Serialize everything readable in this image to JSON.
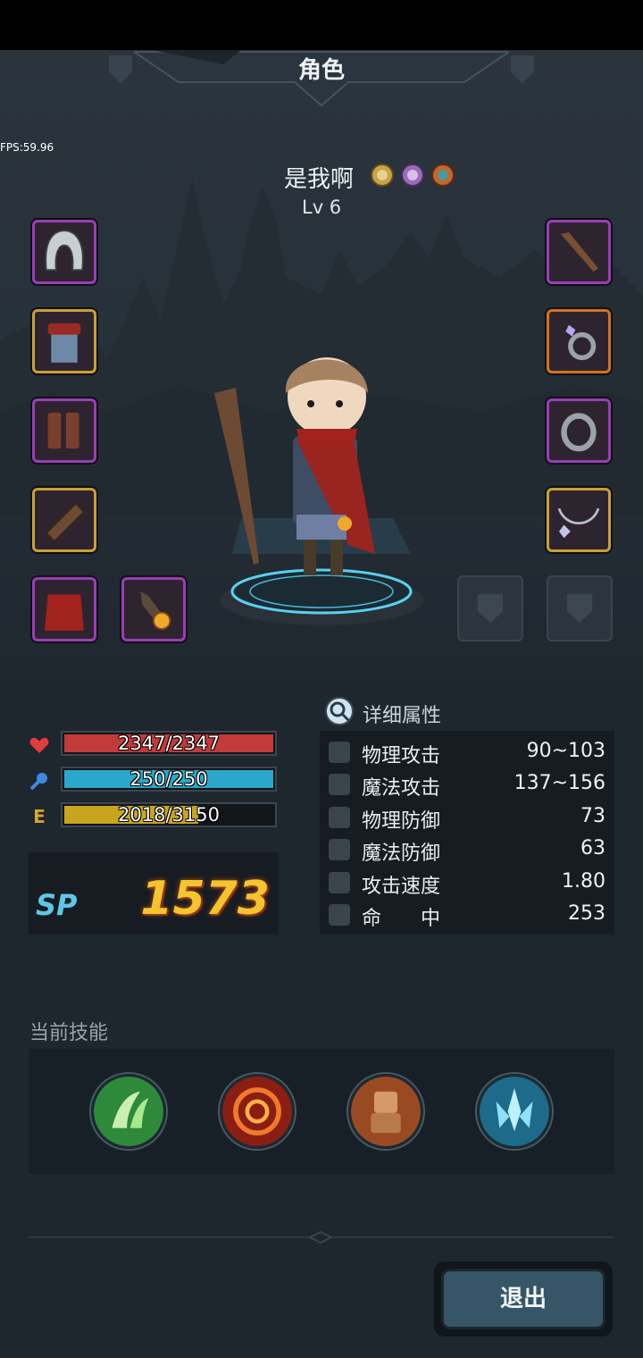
{
  "header": {
    "title": "角色",
    "fps": "FPS:59.96"
  },
  "character": {
    "name": "是我啊",
    "level": "Lv 6"
  },
  "medals": [
    "gold-medal-icon",
    "purple-medal-icon",
    "bronze-medal-icon"
  ],
  "equipment": {
    "left": [
      "hood-icon",
      "tunic-icon",
      "boots-icon",
      "bracer-icon",
      "cape-icon",
      "amulet-gem-icon"
    ],
    "right": [
      "staff-icon",
      "gem-ring-icon",
      "iron-ring-icon",
      "necklace-icon",
      "empty-slot-icon",
      "empty-slot-icon"
    ]
  },
  "bars": {
    "hp": {
      "text": "2347/2347",
      "fill": 1.0,
      "color": "#c23a3a"
    },
    "mp": {
      "text": "250/250",
      "fill": 1.0,
      "color": "#2aa8cc"
    },
    "exp": {
      "text": "2018/3150",
      "fill": 0.64,
      "color": "#c9a41f",
      "icon_label": "E"
    }
  },
  "sp": {
    "label": "SP",
    "value": "1573"
  },
  "details": {
    "title": "详细属性",
    "stats": [
      {
        "name": "物理攻击",
        "value": "90~103"
      },
      {
        "name": "魔法攻击",
        "value": "137~156"
      },
      {
        "name": "物理防御",
        "value": "73"
      },
      {
        "name": "魔法防御",
        "value": "63"
      },
      {
        "name": "攻击速度",
        "value": "1.80"
      },
      {
        "name": "命　　中",
        "value": "253"
      }
    ]
  },
  "skills": {
    "label": "当前技能",
    "items": [
      "wind-slash-skill-icon",
      "fire-vortex-skill-icon",
      "stone-golem-skill-icon",
      "ice-crystal-skill-icon"
    ]
  },
  "exit": {
    "label": "退出"
  }
}
